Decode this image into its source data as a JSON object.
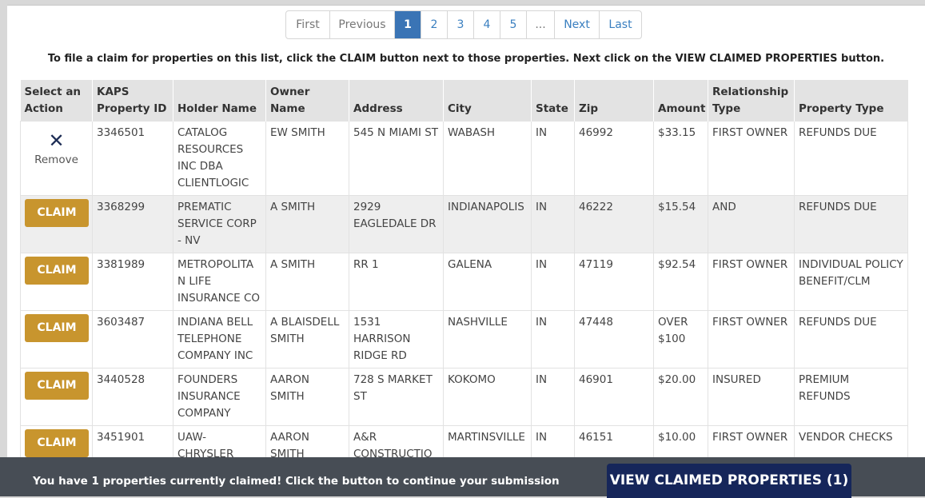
{
  "pagination": {
    "first": "First",
    "previous": "Previous",
    "pages": [
      "1",
      "2",
      "3",
      "4",
      "5",
      "..."
    ],
    "active_page": "1",
    "next": "Next",
    "last": "Last"
  },
  "instruction": "To file a claim for properties on this list, click the CLAIM button next to those properties. Next click on the VIEW CLAIMED PROPERTIES button.",
  "table": {
    "headers": {
      "action": "Select an Action",
      "kaps_id": "KAPS Property ID",
      "holder": "Holder Name",
      "owner": "Owner Name",
      "address": "Address",
      "city": "City",
      "state": "State",
      "zip": "Zip",
      "amount": "Amount",
      "relationship": "Relationship Type",
      "property_type": "Property Type"
    },
    "claim_label": "CLAIM",
    "remove_label": "Remove",
    "rows": [
      {
        "action": "remove",
        "kaps_id": "3346501",
        "holder": "CATALOG RESOURCES INC DBA CLIENTLOGIC",
        "owner": "EW SMITH",
        "address": "545 N MIAMI ST",
        "city": "WABASH",
        "state": "IN",
        "zip": "46992",
        "amount": "$33.15",
        "relationship": "FIRST OWNER",
        "property_type": "REFUNDS DUE"
      },
      {
        "action": "claim",
        "kaps_id": "3368299",
        "holder": "PREMATIC SERVICE CORP - NV",
        "owner": "A SMITH",
        "address": "2929 EAGLEDALE DR",
        "city": "INDIANAPOLIS",
        "state": "IN",
        "zip": "46222",
        "amount": "$15.54",
        "relationship": "AND",
        "property_type": "REFUNDS DUE"
      },
      {
        "action": "claim",
        "kaps_id": "3381989",
        "holder": "METROPOLITAN LIFE INSURANCE CO",
        "owner": "A SMITH",
        "address": "RR 1",
        "city": "GALENA",
        "state": "IN",
        "zip": "47119",
        "amount": "$92.54",
        "relationship": "FIRST OWNER",
        "property_type": "INDIVIDUAL POLICY BENEFIT/CLM"
      },
      {
        "action": "claim",
        "kaps_id": "3603487",
        "holder": "INDIANA BELL TELEPHONE COMPANY INC",
        "owner": "A BLAISDELL SMITH",
        "address": "1531 HARRISON RIDGE RD",
        "city": "NASHVILLE",
        "state": "IN",
        "zip": "47448",
        "amount": "OVER $100",
        "relationship": "FIRST OWNER",
        "property_type": "REFUNDS DUE"
      },
      {
        "action": "claim",
        "kaps_id": "3440528",
        "holder": "FOUNDERS INSURANCE COMPANY",
        "owner": "AARON SMITH",
        "address": "728 S MARKET ST",
        "city": "KOKOMO",
        "state": "IN",
        "zip": "46901",
        "amount": "$20.00",
        "relationship": "INSURED",
        "property_type": "PREMIUM REFUNDS"
      },
      {
        "action": "claim",
        "kaps_id": "3451901",
        "holder": "UAW-CHRYSLER LEGAL",
        "owner": "AARON SMITH",
        "address": "A&R CONSTRUCTION",
        "city": "MARTINSVILLE",
        "state": "IN",
        "zip": "46151",
        "amount": "$10.00",
        "relationship": "FIRST OWNER",
        "property_type": "VENDOR CHECKS"
      }
    ]
  },
  "footer": {
    "message": "You have 1 properties currently claimed! Click the button to continue your submission",
    "button_label": "VIEW CLAIMED PROPERTIES (1)"
  },
  "colors": {
    "claim_button": "#c8952e",
    "active_page": "#3a74b5",
    "view_button": "#16265a",
    "footer_bar": "#474d55"
  }
}
